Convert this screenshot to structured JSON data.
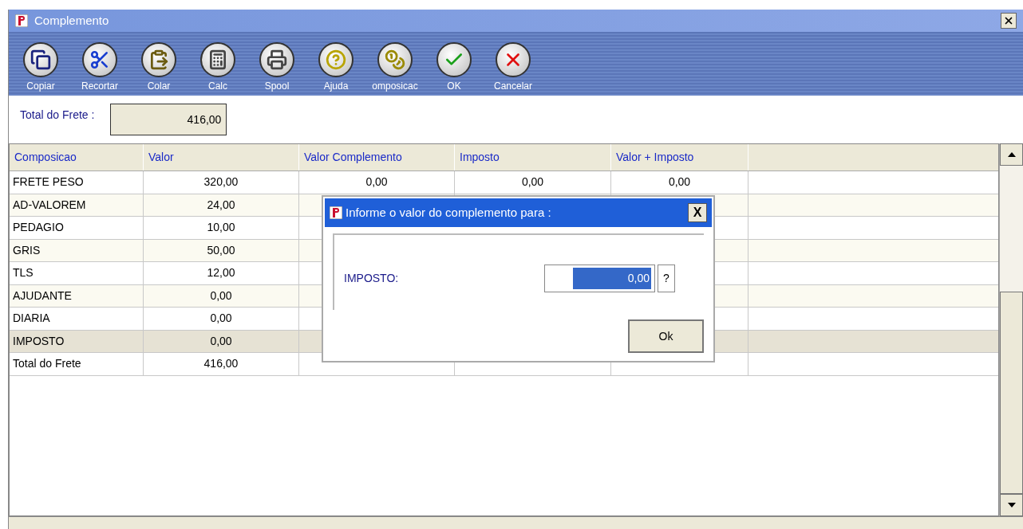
{
  "window": {
    "title": "Complemento"
  },
  "toolbar": [
    {
      "label": "Copiar",
      "kind": "copy"
    },
    {
      "label": "Recortar",
      "kind": "cut"
    },
    {
      "label": "Colar",
      "kind": "paste"
    },
    {
      "label": "Calc",
      "kind": "calc"
    },
    {
      "label": "Spool",
      "kind": "print"
    },
    {
      "label": "Ajuda",
      "kind": "help"
    },
    {
      "label": "omposicac",
      "kind": "money"
    },
    {
      "label": "OK",
      "kind": "ok"
    },
    {
      "label": "Cancelar",
      "kind": "cancel"
    }
  ],
  "total_field": {
    "label": "Total do Frete :",
    "value": "416,00"
  },
  "table": {
    "columns": [
      "Composicao",
      "Valor",
      "Valor Complemento",
      "Imposto",
      "Valor + Imposto"
    ],
    "rows": [
      {
        "cells": [
          "FRETE PESO",
          "320,00",
          "0,00",
          "0,00",
          "0,00"
        ],
        "selected": false
      },
      {
        "cells": [
          "AD-VALOREM",
          "24,00"
        ],
        "selected": false
      },
      {
        "cells": [
          "PEDAGIO",
          "10,00"
        ],
        "selected": false
      },
      {
        "cells": [
          "GRIS",
          "50,00"
        ],
        "selected": false
      },
      {
        "cells": [
          "TLS",
          "12,00"
        ],
        "selected": false
      },
      {
        "cells": [
          "AJUDANTE",
          "0,00"
        ],
        "selected": false
      },
      {
        "cells": [
          "DIARIA",
          "0,00"
        ],
        "selected": false
      },
      {
        "cells": [
          "IMPOSTO",
          "0,00"
        ],
        "selected": true
      },
      {
        "cells": [
          "Total do Frete",
          "416,00"
        ],
        "selected": false
      }
    ]
  },
  "dialog": {
    "title": "Informe o valor do complemento para :",
    "close": "X",
    "field_label": "IMPOSTO:",
    "value": "0,00",
    "help": "?",
    "button": "Ok"
  }
}
